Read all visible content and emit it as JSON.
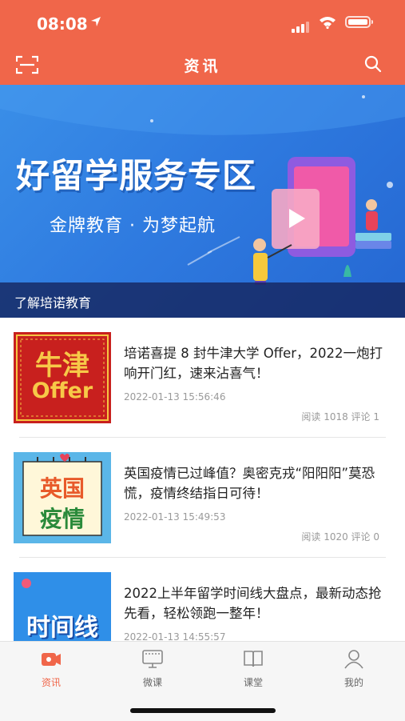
{
  "status_bar": {
    "time": "08:08"
  },
  "nav": {
    "title": "资讯"
  },
  "banner": {
    "title": "好留学服务专区",
    "subtitle": "金牌教育 · 为梦起航",
    "link": "了解培诺教育"
  },
  "articles": [
    {
      "thumb_text": [
        "牛津",
        "Offer"
      ],
      "title": "培诺喜提 8 封牛津大学 Offer，2022一炮打响开门红，速来沾喜气！",
      "date": "2022-01-13 15:56:46",
      "stats": "阅读 1018  评论 1"
    },
    {
      "thumb_text": [
        "英国",
        "疫情"
      ],
      "title": "英国疫情已过峰值？奥密克戎“阳阳阳”莫恐慌，疫情终结指日可待！",
      "date": "2022-01-13 15:49:53",
      "stats": "阅读 1020  评论 0"
    },
    {
      "thumb_text": [
        "时间线"
      ],
      "title": "2022上半年留学时间线大盘点，最新动态抢先看，轻松领跑一整年！",
      "date": "2022-01-13 14:55:57",
      "stats": ""
    }
  ],
  "tabs": [
    {
      "label": "资讯",
      "active": true
    },
    {
      "label": "微课",
      "active": false
    },
    {
      "label": "课堂",
      "active": false
    },
    {
      "label": "我的",
      "active": false
    }
  ],
  "colors": {
    "brand": "#f0664a",
    "banner": "#2f7be0"
  }
}
